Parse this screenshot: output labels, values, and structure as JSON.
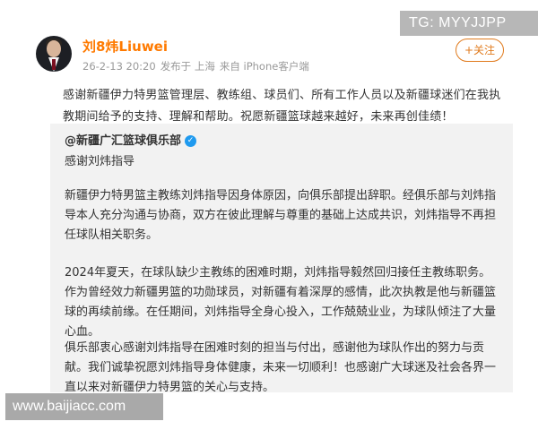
{
  "watermarks": {
    "top_right": "TG: MYYJJPP",
    "bottom_left": "www.baijiacc.com"
  },
  "post": {
    "username": "刘8炜Liuwei",
    "time": "26-2-13 20:20",
    "location": "发布于 上海",
    "device": "来自 iPhone客户端",
    "follow_label": "+关注",
    "text": "感谢新疆伊力特男篮管理层、教练组、球员们、所有工作人员以及新疆球迷们在我执教期间给予的支持、理解和帮助。祝愿新疆篮球越来越好，未来再创佳绩！"
  },
  "repost": {
    "source": "@新疆广汇篮球俱乐部",
    "paragraphs": [
      "感谢刘炜指导",
      "新疆伊力特男篮主教练刘炜指导因身体原因，向俱乐部提出辞职。经俱乐部与刘炜指导本人充分沟通与协商，双方在彼此理解与尊重的基础上达成共识，刘炜指导不再担任球队相关职务。",
      "2024年夏天，在球队缺少主教练的困难时期，刘炜指导毅然回归接任主教练职务。作为曾经效力新疆男篮的功勋球员，对新疆有着深厚的感情，此次执教是他与新疆篮球的再续前缘。在任期间，刘炜指导全身心投入，工作兢兢业业，为球队倾注了大量心血。",
      "俱乐部衷心感谢刘炜指导在困难时刻的担当与付出，感谢他为球队作出的努力与贡献。我们诚挚祝愿刘炜指导身体健康，未来一切顺利！也感谢广大球迷及社会各界一直以来对新疆伊力特男篮的关心与支持。"
    ]
  },
  "colors": {
    "username": "#ff7a00",
    "follow": "#e07a1c",
    "verified": "#1f9aef",
    "repost_bg": "#f2f2f2"
  },
  "icons": {
    "verified": "verified-check-icon",
    "avatar": "user-avatar"
  }
}
